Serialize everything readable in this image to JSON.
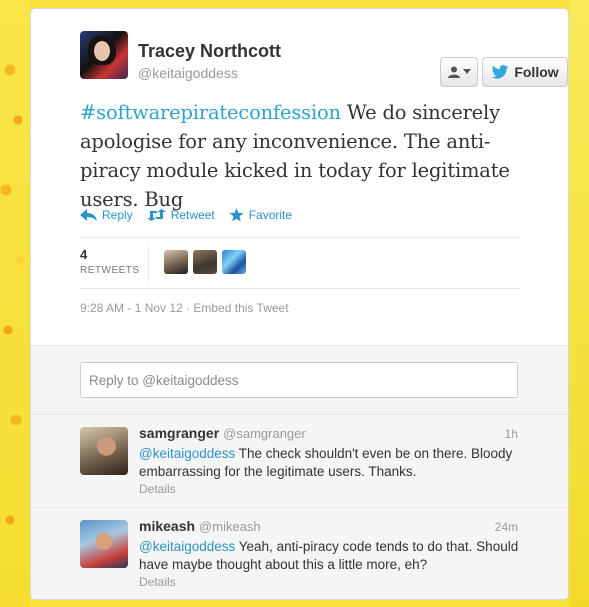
{
  "tweet": {
    "author_name": "Tracey Northcott",
    "author_handle": "@keitaigoddess",
    "hashtag": "#softwarepirateconfession",
    "text": " We do sincerely apologise for any inconvenience. The anti-piracy module kicked in today for legitimate users. Bug",
    "timestamp": "9:28 AM - 1 Nov 12 · Embed this Tweet"
  },
  "buttons": {
    "follow_label": "Follow"
  },
  "actions": {
    "reply_label": "Reply",
    "retweet_label": "Retweet",
    "favorite_label": "Favorite"
  },
  "stats": {
    "retweet_count": "4",
    "retweet_label": "RETWEETS"
  },
  "reply_box": {
    "placeholder": "Reply to @keitaigoddess"
  },
  "replies": [
    {
      "name": "samgranger",
      "handle": "@samgranger",
      "time": "1h",
      "mention": "@keitaigoddess",
      "text": " The check shouldn't even be on there. Bloody embarrassing for the legitimate users. Thanks.",
      "details_label": "Details"
    },
    {
      "name": "mikeash",
      "handle": "@mikeash",
      "time": "24m",
      "mention": "@keitaigoddess",
      "text": " Yeah, anti-piracy code tends to do that. Should have maybe thought about this a little more, eh?",
      "details_label": "Details"
    }
  ],
  "colors": {
    "link": "#2b93c8",
    "hashtag": "#2fa3cc",
    "twitter_bird": "#33a6dd",
    "background": "#f7e23a"
  },
  "icons": [
    "user-icon",
    "caret-down-icon",
    "twitter-bird-icon",
    "reply-icon",
    "retweet-icon",
    "favorite-star-icon"
  ]
}
